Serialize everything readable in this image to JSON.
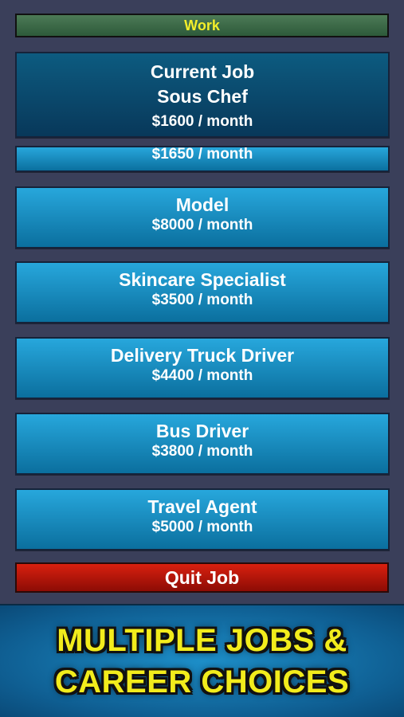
{
  "header": {
    "title": "Work"
  },
  "current_job": {
    "heading": "Current Job",
    "title": "Sous Chef",
    "salary": "$1600 / month"
  },
  "partial_job": {
    "salary": "$1650 / month"
  },
  "jobs": [
    {
      "title": "Model",
      "salary": "$8000 / month"
    },
    {
      "title": "Skincare Specialist",
      "salary": "$3500 / month"
    },
    {
      "title": "Delivery Truck Driver",
      "salary": "$4400 / month"
    },
    {
      "title": "Bus Driver",
      "salary": "$3800 / month"
    },
    {
      "title": "Travel Agent",
      "salary": "$5000 / month"
    }
  ],
  "quit_button": {
    "label": "Quit Job"
  },
  "banner": {
    "line1": "MULTIPLE JOBS &",
    "line2": "CAREER CHOICES"
  },
  "colors": {
    "background": "#3a3f5a",
    "header_text": "#f3ee2a",
    "job_button": "#1a8fc4",
    "current_job": "#0b4a6e",
    "quit_button": "#c4170c",
    "banner_text": "#f2ec1c"
  }
}
